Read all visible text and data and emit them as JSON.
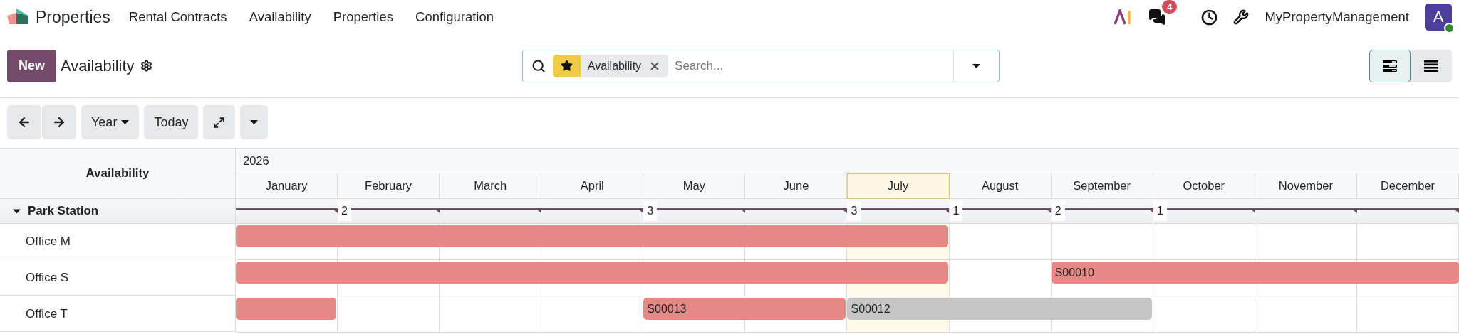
{
  "navbar": {
    "brand": "Properties",
    "menu": [
      "Rental Contracts",
      "Availability",
      "Properties",
      "Configuration"
    ],
    "chat_badge": "4",
    "company": "MyPropertyManagement",
    "avatar": "A"
  },
  "control_panel": {
    "new_button": "New",
    "title": "Availability",
    "search": {
      "facet": "Availability",
      "placeholder": "Search..."
    },
    "views": [
      {
        "kind": "gantt",
        "selected": true
      },
      {
        "kind": "list",
        "selected": false
      }
    ]
  },
  "toolbar": {
    "period": "Year",
    "today": "Today"
  },
  "gantt": {
    "header": "Availability",
    "year": "2026",
    "months": [
      {
        "label": "January",
        "today": false
      },
      {
        "label": "February",
        "today": false
      },
      {
        "label": "March",
        "today": false
      },
      {
        "label": "April",
        "today": false
      },
      {
        "label": "May",
        "today": false
      },
      {
        "label": "June",
        "today": false
      },
      {
        "label": "July",
        "today": true
      },
      {
        "label": "August",
        "today": false
      },
      {
        "label": "September",
        "today": false
      },
      {
        "label": "October",
        "today": false
      },
      {
        "label": "November",
        "today": false
      },
      {
        "label": "December",
        "today": false
      }
    ],
    "group": {
      "name": "Park Station",
      "expanded": true,
      "segments": [
        {
          "kind": "line"
        },
        {
          "kind": "line",
          "count": "2"
        },
        {
          "kind": "line"
        },
        {
          "kind": "line"
        },
        {
          "kind": "line",
          "count": "3"
        },
        {
          "kind": "line"
        },
        {
          "kind": "line",
          "count": "3"
        },
        {
          "kind": "line",
          "count": "1"
        },
        {
          "kind": "line",
          "count": "2"
        },
        {
          "kind": "line",
          "count": "1"
        },
        {
          "kind": "line"
        },
        {
          "kind": "line"
        }
      ]
    },
    "rows": [
      {
        "name": "Office M",
        "cells": [
          {
            "kind": "start",
            "color": "#e68883"
          },
          {
            "kind": "continue"
          },
          {
            "kind": "continue"
          },
          {
            "kind": "continue"
          },
          {
            "kind": "continue"
          },
          {
            "kind": "continue"
          },
          {
            "kind": "continue"
          },
          {
            "kind": "empty"
          },
          {
            "kind": "empty"
          },
          {
            "kind": "empty"
          },
          {
            "kind": "empty"
          },
          {
            "kind": "empty"
          }
        ]
      },
      {
        "name": "Office S",
        "cells": [
          {
            "kind": "start",
            "color": "#e68883"
          },
          {
            "kind": "continue"
          },
          {
            "kind": "continue"
          },
          {
            "kind": "continue"
          },
          {
            "kind": "continue"
          },
          {
            "kind": "continue"
          },
          {
            "kind": "continue"
          },
          {
            "kind": "empty"
          },
          {
            "kind": "start",
            "label": "S00010",
            "color": "#e68883"
          },
          {
            "kind": "continue"
          },
          {
            "kind": "continue"
          },
          {
            "kind": "continue"
          }
        ]
      },
      {
        "name": "Office T",
        "cells": [
          {
            "kind": "start",
            "color": "#e68883"
          },
          {
            "kind": "empty"
          },
          {
            "kind": "empty"
          },
          {
            "kind": "empty"
          },
          {
            "kind": "start",
            "label": "S00013",
            "color": "#e68883"
          },
          {
            "kind": "continue"
          },
          {
            "kind": "start",
            "label": "S00012",
            "color": "#c6c6c6"
          },
          {
            "kind": "continue"
          },
          {
            "kind": "continue"
          },
          {
            "kind": "empty"
          },
          {
            "kind": "empty"
          },
          {
            "kind": "empty"
          }
        ]
      }
    ]
  }
}
